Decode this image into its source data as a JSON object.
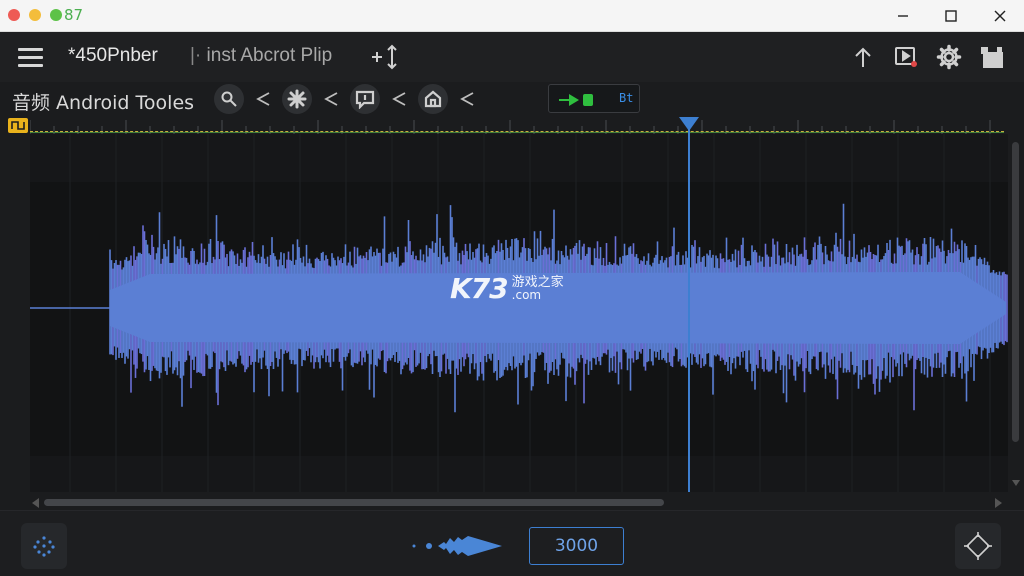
{
  "window": {
    "title_number": "87"
  },
  "toolbar": {
    "project_title": "*450Pnber",
    "project_subtitle": "inst Abcrot Plip",
    "icons": [
      "menu-icon",
      "zoom-vertical-icon",
      "export-up-icon",
      "preview-icon",
      "settings-gear-icon",
      "plugin-icon"
    ]
  },
  "row2": {
    "app_label": "音频 Android Tooles",
    "tools": [
      "search-icon",
      "share-icon",
      "effects-icon",
      "share-icon",
      "comment-icon",
      "share-icon",
      "home-icon",
      "share-icon"
    ],
    "playback_label": "Bt"
  },
  "watermark": {
    "brand": "K73",
    "chinese": "游戏之家",
    "domain": ".com"
  },
  "bottom": {
    "value": "3000"
  },
  "colors": {
    "waveform": "#5b7fd4",
    "accent": "#3d7fd1",
    "loop": "#e9b21c",
    "play": "#2fbf3f"
  }
}
